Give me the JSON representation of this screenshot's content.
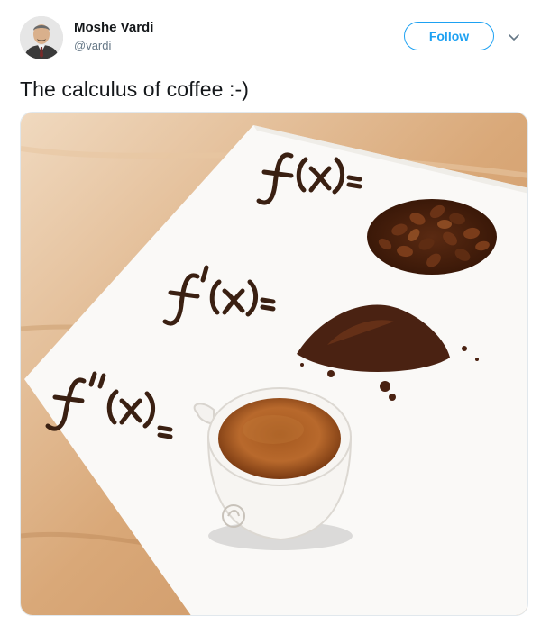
{
  "user": {
    "name": "Moshe Vardi",
    "handle": "@vardi",
    "avatar_icon": "profile-photo"
  },
  "follow_button": {
    "label": "Follow"
  },
  "menu_caret_icon": "chevron-down-icon",
  "tweet": {
    "text": "The calculus of coffee :-)"
  },
  "media": {
    "handwritten_labels": [
      "f(x)=",
      "f'(x)=",
      "f''(x)="
    ],
    "items": [
      "coffee-beans",
      "ground-coffee",
      "espresso-cup"
    ]
  },
  "colors": {
    "accent": "#1da1f2",
    "text": "#14171a",
    "secondary": "#657786"
  }
}
